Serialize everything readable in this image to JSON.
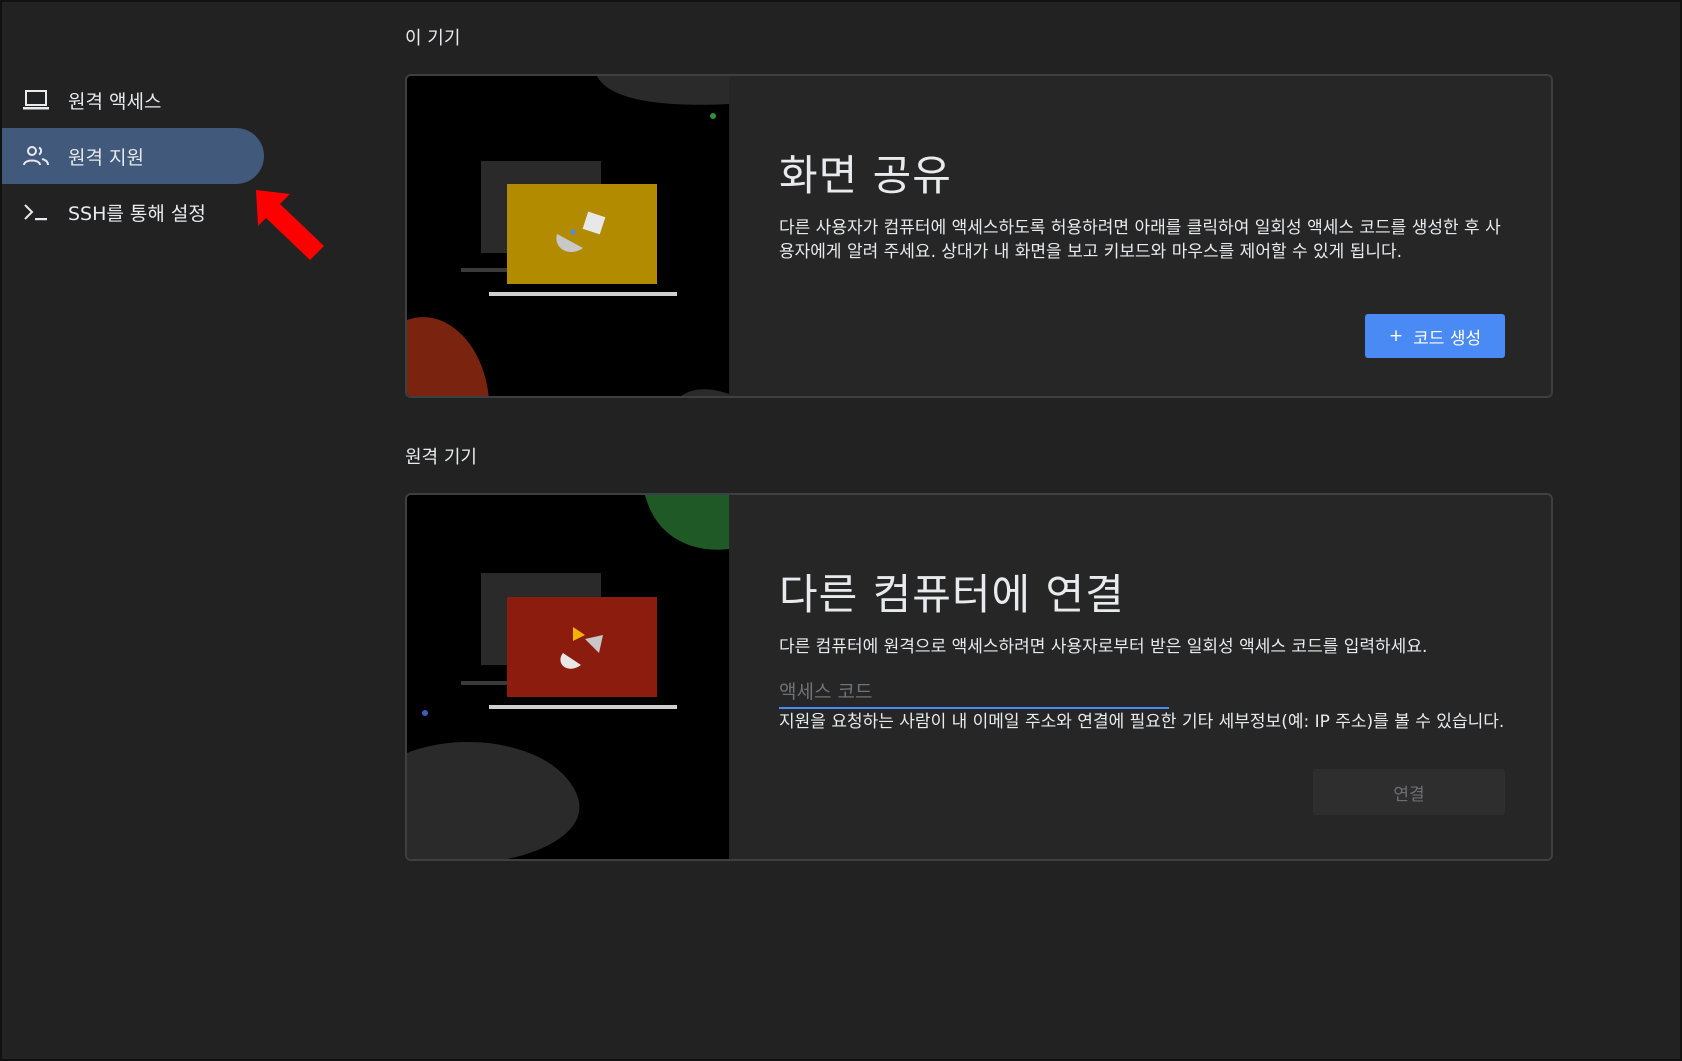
{
  "sidebar": {
    "items": [
      {
        "label": "원격 액세스",
        "icon": "laptop-icon",
        "active": false
      },
      {
        "label": "원격 지원",
        "icon": "people-icon",
        "active": true
      },
      {
        "label": "SSH를 통해 설정",
        "icon": "terminal-icon",
        "active": false
      }
    ]
  },
  "sections": {
    "this_device": {
      "title": "이 기기",
      "card": {
        "heading": "화면 공유",
        "description": "다른 사용자가 컴퓨터에 액세스하도록 허용하려면 아래를 클릭하여 일회성 액세스 코드를 생성한 후 사용자에게 알려 주세요. 상대가 내 화면을 보고 키보드와 마우스를 제어할 수 있게 됩니다.",
        "button_icon": "+",
        "button_label": "코드 생성"
      }
    },
    "remote_device": {
      "title": "원격 기기",
      "card": {
        "heading": "다른 컴퓨터에 연결",
        "description": "다른 컴퓨터에 원격으로 액세스하려면 사용자로부터 받은 일회성 액세스 코드를 입력하세요.",
        "input_placeholder": "액세스 코드",
        "input_value": "",
        "helper": "지원을 요청하는 사람이 내 이메일 주소와 연결에 필요한 기타 세부정보(예: IP 주소)를 볼 수 있습니다.",
        "button_label": "연결"
      }
    }
  },
  "colors": {
    "background": "#222222",
    "active_nav": "#41597a",
    "primary_button": "#4a8af4",
    "art_yellow": "#b38b00",
    "art_red": "#8c1d0e",
    "art_green": "#1f5a26",
    "art_rust": "#7a2410",
    "annotation_arrow": "#ff0000"
  }
}
